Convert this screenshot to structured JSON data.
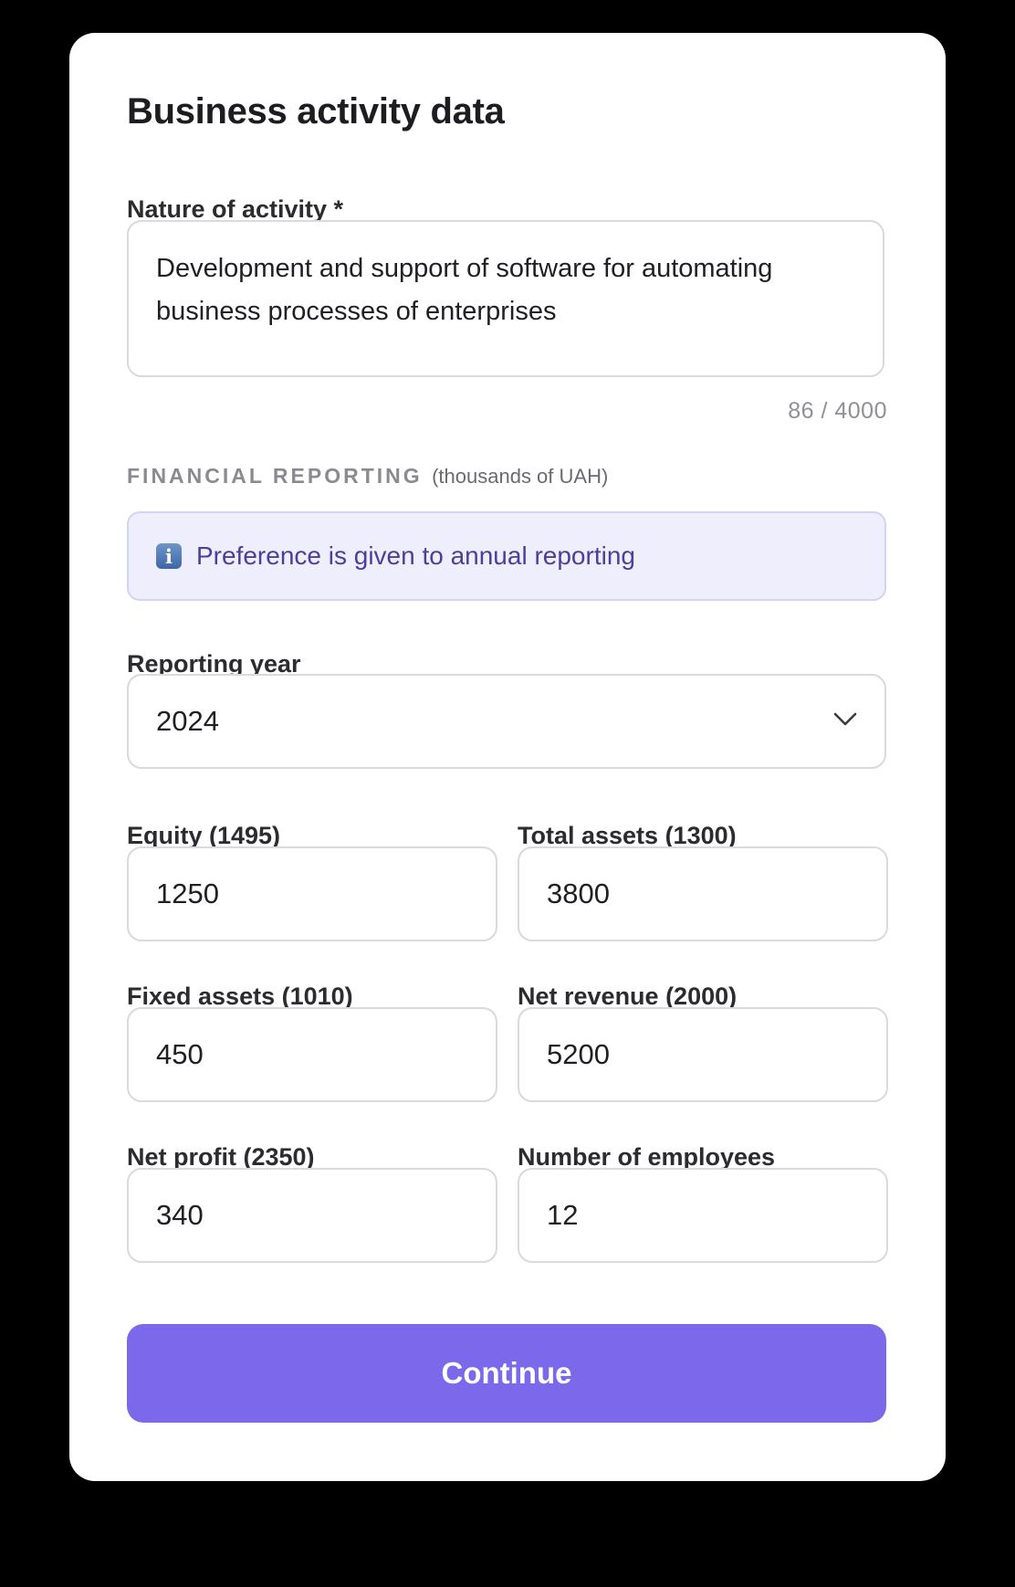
{
  "form": {
    "title": "Business activity data",
    "nature_label": "Nature of activity *",
    "nature_value": "Development and support of software for automating business processes of enterprises",
    "char_counter": "86 / 4000",
    "section_title": "FINANCIAL REPORTING",
    "section_unit": "(thousands of UAH)",
    "info_icon_glyph": "i",
    "info_text": "Preference is given to annual reporting",
    "year_label": "Reporting year",
    "year_value": "2024",
    "fields": {
      "equity": {
        "label": "Equity (1495)",
        "value": "1250"
      },
      "total_assets": {
        "label": "Total assets (1300)",
        "value": "3800"
      },
      "fixed_assets": {
        "label": "Fixed assets (1010)",
        "value": "450"
      },
      "net_revenue": {
        "label": "Net revenue (2000)",
        "value": "5200"
      },
      "net_profit": {
        "label": "Net profit (2350)",
        "value": "340"
      },
      "employees": {
        "label": "Number of employees",
        "value": "12"
      }
    },
    "continue_label": "Continue"
  },
  "icons": {
    "info": "info-icon",
    "dropdown": "chevron-down-icon"
  },
  "colors": {
    "background": "#000000",
    "card": "#ffffff",
    "accent": "#7b68ea",
    "info_bg": "#eeeefd",
    "info_border": "#d4d2f6",
    "info_text": "#4a3f9c",
    "input_border": "#d9d9de"
  }
}
